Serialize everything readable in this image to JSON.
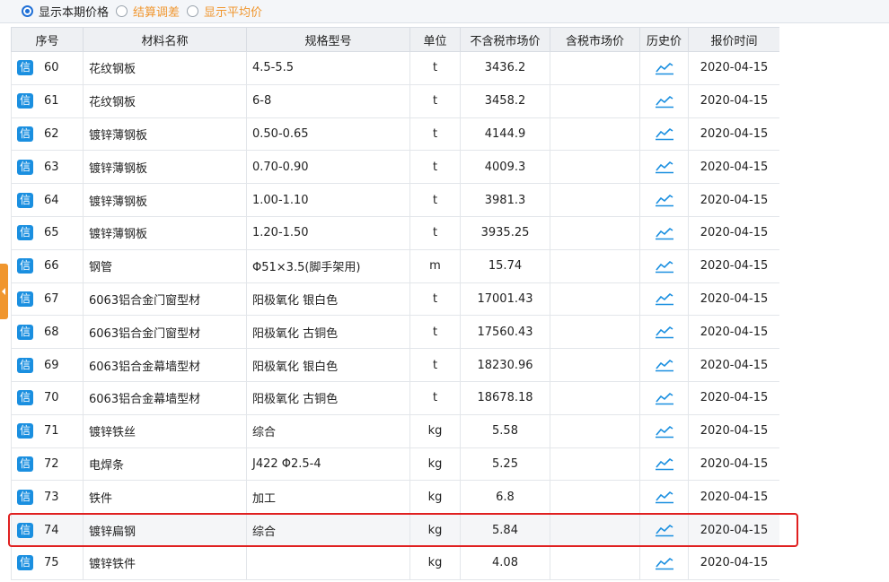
{
  "options": {
    "current": "显示本期价格",
    "settlement": "结算调差",
    "average": "显示平均价"
  },
  "columns": [
    "序号",
    "材料名称",
    "规格型号",
    "单位",
    "不含税市场价",
    "含税市场价",
    "历史价",
    "报价时间"
  ],
  "badge_text": "信",
  "rows": [
    {
      "no": "60",
      "name": "花纹钢板",
      "spec": "4.5-5.5",
      "unit": "t",
      "price": "3436.2",
      "tax_price": "",
      "date": "2020-04-15"
    },
    {
      "no": "61",
      "name": "花纹钢板",
      "spec": "6-8",
      "unit": "t",
      "price": "3458.2",
      "tax_price": "",
      "date": "2020-04-15"
    },
    {
      "no": "62",
      "name": "镀锌薄钢板",
      "spec": "0.50-0.65",
      "unit": "t",
      "price": "4144.9",
      "tax_price": "",
      "date": "2020-04-15"
    },
    {
      "no": "63",
      "name": "镀锌薄钢板",
      "spec": "0.70-0.90",
      "unit": "t",
      "price": "4009.3",
      "tax_price": "",
      "date": "2020-04-15"
    },
    {
      "no": "64",
      "name": "镀锌薄钢板",
      "spec": "1.00-1.10",
      "unit": "t",
      "price": "3981.3",
      "tax_price": "",
      "date": "2020-04-15"
    },
    {
      "no": "65",
      "name": "镀锌薄钢板",
      "spec": "1.20-1.50",
      "unit": "t",
      "price": "3935.25",
      "tax_price": "",
      "date": "2020-04-15"
    },
    {
      "no": "66",
      "name": "钢管",
      "spec": "Φ51×3.5(脚手架用)",
      "unit": "m",
      "price": "15.74",
      "tax_price": "",
      "date": "2020-04-15"
    },
    {
      "no": "67",
      "name": "6063铝合金门窗型材",
      "spec": "阳极氧化 银白色",
      "unit": "t",
      "price": "17001.43",
      "tax_price": "",
      "date": "2020-04-15"
    },
    {
      "no": "68",
      "name": "6063铝合金门窗型材",
      "spec": "阳极氧化 古铜色",
      "unit": "t",
      "price": "17560.43",
      "tax_price": "",
      "date": "2020-04-15"
    },
    {
      "no": "69",
      "name": "6063铝合金幕墙型材",
      "spec": "阳极氧化 银白色",
      "unit": "t",
      "price": "18230.96",
      "tax_price": "",
      "date": "2020-04-15"
    },
    {
      "no": "70",
      "name": "6063铝合金幕墙型材",
      "spec": "阳极氧化 古铜色",
      "unit": "t",
      "price": "18678.18",
      "tax_price": "",
      "date": "2020-04-15"
    },
    {
      "no": "71",
      "name": "镀锌铁丝",
      "spec": "综合",
      "unit": "kg",
      "price": "5.58",
      "tax_price": "",
      "date": "2020-04-15"
    },
    {
      "no": "72",
      "name": "电焊条",
      "spec": "J422 Φ2.5-4",
      "unit": "kg",
      "price": "5.25",
      "tax_price": "",
      "date": "2020-04-15"
    },
    {
      "no": "73",
      "name": "铁件",
      "spec": "加工",
      "unit": "kg",
      "price": "6.8",
      "tax_price": "",
      "date": "2020-04-15"
    },
    {
      "no": "74",
      "name": "镀锌扁钢",
      "spec": "综合",
      "unit": "kg",
      "price": "5.84",
      "tax_price": "",
      "date": "2020-04-15",
      "highlighted": true
    },
    {
      "no": "75",
      "name": "镀锌铁件",
      "spec": "",
      "unit": "kg",
      "price": "4.08",
      "tax_price": "",
      "date": "2020-04-15"
    }
  ],
  "colors": {
    "accent": "#1f6fd6",
    "badge": "#1a8fe0",
    "orange": "#f0962e",
    "highlight_border": "#e02020"
  },
  "icons": {
    "history": "trend-chart-icon",
    "side_toggle": "collapse-arrow-icon"
  }
}
